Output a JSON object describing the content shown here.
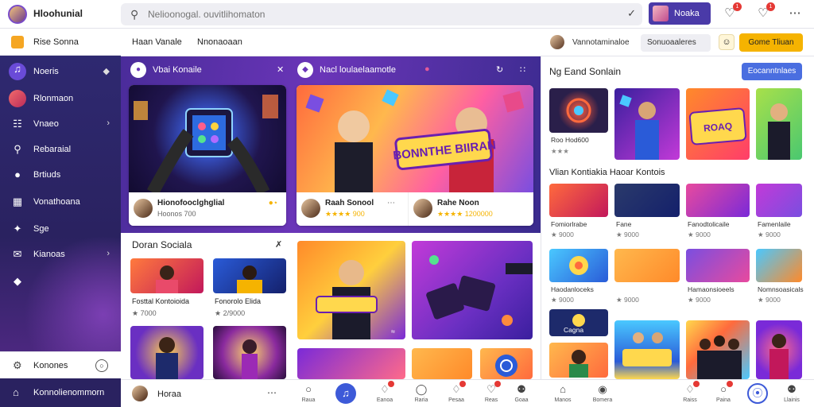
{
  "topbar": {
    "brand": "Hloohunial",
    "search_placeholder": "Nelioonogal. ouvitlihomaton",
    "profile_label": "Noaka",
    "notification_count_1": "1",
    "notification_count_2": "1",
    "icons": [
      "search-icon",
      "mic-icon",
      "bell-icon",
      "bell-icon",
      "grid-icon"
    ]
  },
  "sidebar": {
    "top_item": "Rise Sonna",
    "items": [
      {
        "label": "Noeris",
        "icon": "music-icon"
      },
      {
        "label": "Rlonmaon",
        "icon": "avatar-icon"
      },
      {
        "label": "Vnaeo",
        "icon": "book-icon"
      },
      {
        "label": "Rebaraial",
        "icon": "search-icon"
      },
      {
        "label": "Brtiuds",
        "icon": "people-icon"
      },
      {
        "label": "Vonathoana",
        "icon": "image-icon"
      },
      {
        "label": "Sge",
        "icon": "lightning-icon"
      },
      {
        "label": "Kianoas",
        "icon": "mail-icon"
      },
      {
        "label": "",
        "icon": "diamond-icon"
      }
    ],
    "bottom_settings": "Konones",
    "bottom_account": "Konnolienommorn"
  },
  "tabs": {
    "tab1": "Haan Vanale",
    "tab2": "Nnonaoaan",
    "user_text": "Vannotaminaloe",
    "search_chip": "Sonuoaaleres",
    "cta": "Gome Tliuan"
  },
  "banner": {
    "left_title": "Vbai Konaile",
    "right_title": "Nacl loulaelaamotle",
    "card1": {
      "title": "Hionofooclghglial",
      "meta": "Hoonos 700"
    },
    "card2": {
      "title": "Raah Sonool",
      "meta": "★★★★ 900"
    },
    "card3": {
      "title": "Rahe Noon",
      "meta": "★★★★ 1200000"
    },
    "poster_text": "BONNTHE BIIRAN"
  },
  "lower_section": {
    "title": "Doran Sociala",
    "tiles": [
      {
        "caption": "Fosttal Kontoioida",
        "meta": "★ 7000"
      },
      {
        "caption": "Fonorolo Elida",
        "meta": "★ 2/9000"
      }
    ]
  },
  "right_panel": {
    "title": "Ng Eand Sonlain",
    "button": "Eocanntnlaes",
    "subtitle": "Vlian Kontiakia Haoar Kontois",
    "row1_captions": [
      "Roo Hod600",
      "",
      "",
      ""
    ],
    "row2_captions": [
      "Fomiorlrabe",
      "Fane",
      "Fanodtolicaile",
      "Famenlaile"
    ],
    "row2_meta": [
      "★ 9000",
      "★ 9000",
      "★ 9000",
      "★ 9000"
    ],
    "row3_captions": [
      "Haodanloceks",
      "",
      "Hamaonsioeels",
      "Nomnsoasicals"
    ],
    "row3_meta": [
      "★ 9000",
      "★ 9000",
      "★ 9000",
      "★ 9000"
    ],
    "small_caption": "Cagna",
    "poster_text": "ROAQ"
  },
  "bottomnav": {
    "user_name": "Horaa",
    "items": [
      {
        "label": "Raua",
        "icon": "chat-icon"
      },
      {
        "label": "",
        "icon": "music-icon"
      },
      {
        "label": "Eanoa",
        "icon": "bell-icon"
      },
      {
        "label": "Raria",
        "icon": "tag-icon"
      },
      {
        "label": "Pesaa",
        "icon": "bell-icon"
      },
      {
        "label": "Reas",
        "icon": "heart-icon"
      },
      {
        "label": "Goaa",
        "icon": "user-icon"
      },
      {
        "label": "Manos",
        "icon": "home-icon"
      },
      {
        "label": "Bomera",
        "icon": "globe-icon"
      },
      {
        "label": "Raiss",
        "icon": "bell-icon"
      },
      {
        "label": "Paina",
        "icon": "chat-icon"
      },
      {
        "label": "",
        "icon": "compass-icon"
      },
      {
        "label": "Llainis",
        "icon": "user-icon"
      }
    ]
  },
  "colors": {
    "sidebar": "#2f2a73",
    "banner": "#6a35b8",
    "accent_blue": "#4a6ee0",
    "accent_yellow": "#f5b301"
  }
}
